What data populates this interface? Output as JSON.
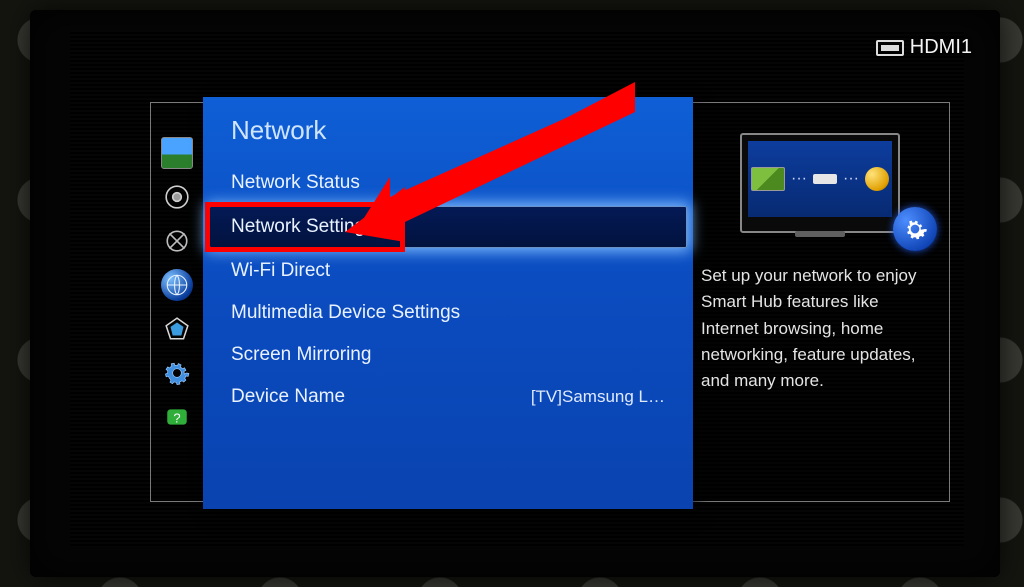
{
  "hdmi_badge": {
    "label": "HDMI1"
  },
  "sidebar": {
    "icons": [
      {
        "name": "picture-icon"
      },
      {
        "name": "sound-icon"
      },
      {
        "name": "channel-icon"
      },
      {
        "name": "network-icon"
      },
      {
        "name": "smart-hub-icon"
      },
      {
        "name": "system-icon"
      },
      {
        "name": "support-icon"
      }
    ]
  },
  "menu": {
    "title": "Network",
    "items": [
      {
        "label": "Network Status",
        "value": ""
      },
      {
        "label": "Network Settings",
        "value": "",
        "selected": true
      },
      {
        "label": "Wi-Fi Direct",
        "value": ""
      },
      {
        "label": "Multimedia Device Settings",
        "value": ""
      },
      {
        "label": "Screen Mirroring",
        "value": ""
      },
      {
        "label": "Device Name",
        "value": "[TV]Samsung L…"
      }
    ]
  },
  "info": {
    "description": "Set up your network to enjoy Smart Hub features like Internet browsing, home networking, feature updates, and many more."
  },
  "annotation": {
    "highlight_index": 1
  }
}
